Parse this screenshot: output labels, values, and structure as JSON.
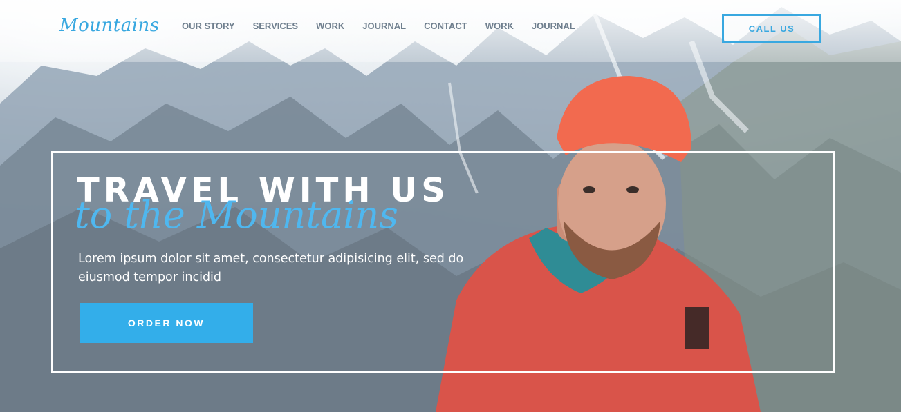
{
  "brand": {
    "logo": "Mountains"
  },
  "nav": {
    "items": [
      "OUR STORY",
      "SERVICES",
      "WORK",
      "JOURNAL",
      "CONTACT",
      "WORK",
      "JOURNAL"
    ]
  },
  "header": {
    "cta_label": "CALL US"
  },
  "hero": {
    "title": "TRAVEL WITH US",
    "script": "to the Mountains",
    "description": "Lorem ipsum dolor sit amet, consectetur adipisicing elit, sed do eiusmod tempor incidid",
    "button_label": "ORDER NOW"
  },
  "colors": {
    "accent": "#39a8e0",
    "button": "#33aeea",
    "nav_text": "#6f7f8e",
    "frame": "#ffffff"
  },
  "icons": [
    "hero-background-image",
    "climber-photo"
  ]
}
